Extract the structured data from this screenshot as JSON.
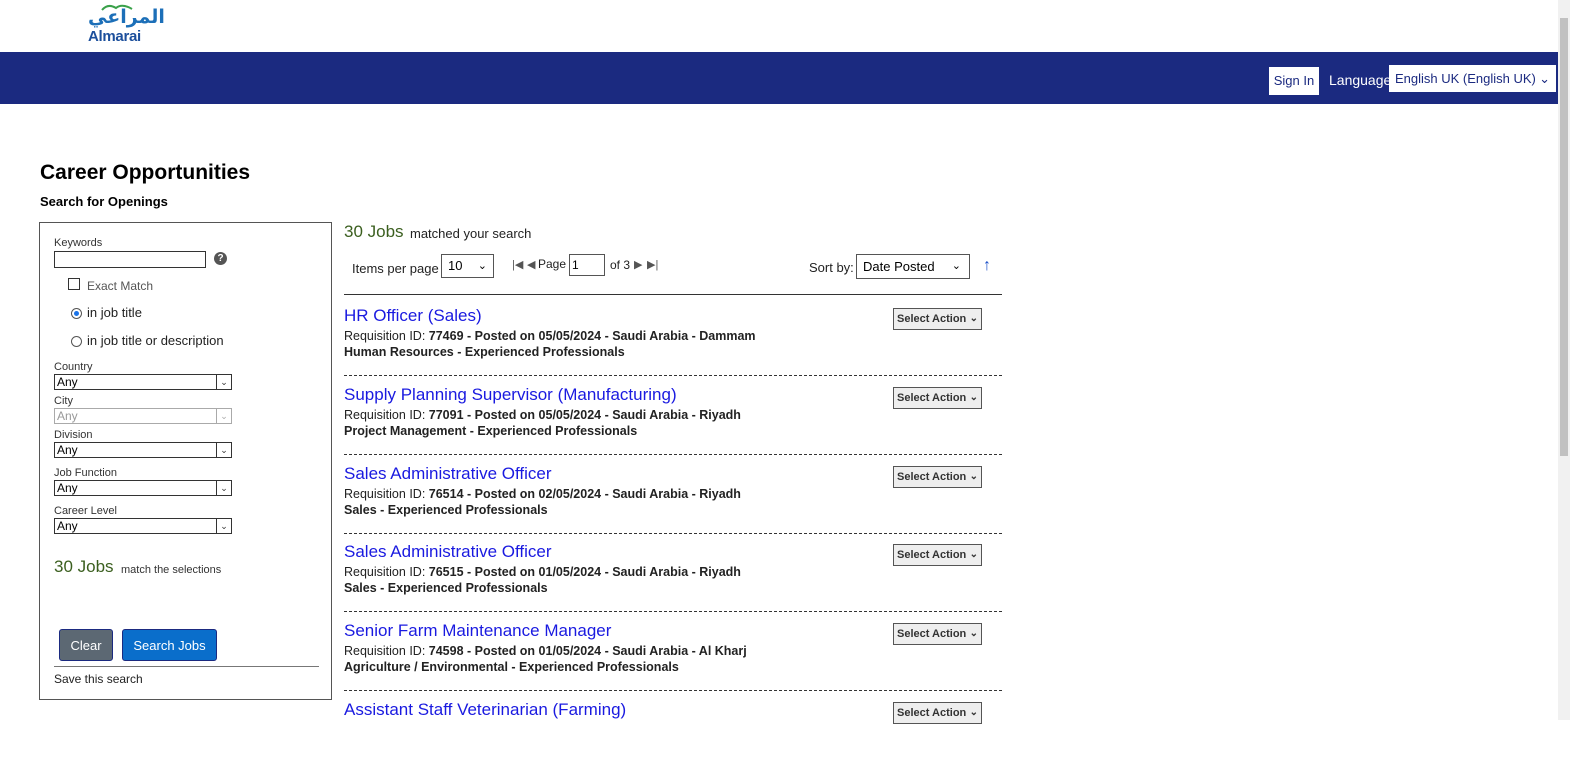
{
  "header": {
    "logo_ar": "المراعي",
    "logo_en": "Almarai",
    "sign_in": "Sign In",
    "language_label": "Language",
    "language_value": "English UK (English UK)"
  },
  "page": {
    "title": "Career Opportunities",
    "subtitle": "Search for Openings"
  },
  "sidebar": {
    "keywords_label": "Keywords",
    "help": "?",
    "exact_match": "Exact Match",
    "radio_title": "in job title",
    "radio_title_desc": "in job title or description",
    "country_label": "Country",
    "country_value": "Any",
    "city_label": "City",
    "city_value": "Any",
    "division_label": "Division",
    "division_value": "Any",
    "job_function_label": "Job Function",
    "job_function_value": "Any",
    "career_level_label": "Career Level",
    "career_level_value": "Any",
    "match_count": "30 Jobs",
    "match_text": "match the selections",
    "clear": "Clear",
    "search": "Search Jobs",
    "save_search": "Save this search"
  },
  "results": {
    "count": "30 Jobs",
    "count_text": "matched your search",
    "items_per_page_label": "Items per page",
    "items_per_page": "10",
    "page_label": "Page",
    "page_value": "1",
    "page_of": "of 3",
    "sort_label": "Sort by:",
    "sort_value": "Date Posted",
    "action_label": "Select Action",
    "jobs": [
      {
        "title": "HR Officer (Sales)",
        "req_label": "Requisition ID:",
        "req": "77469 - Posted on 05/05/2024 - Saudi Arabia  -  Dammam",
        "line2": "Human Resources  -  Experienced Professionals"
      },
      {
        "title": "Supply Planning Supervisor (Manufacturing)",
        "req_label": "Requisition ID:",
        "req": "77091 - Posted on 05/05/2024 - Saudi Arabia  -  Riyadh",
        "line2": "Project Management  -  Experienced Professionals"
      },
      {
        "title": "Sales Administrative Officer",
        "req_label": "Requisition ID:",
        "req": "76514 - Posted on 02/05/2024 - Saudi Arabia  -  Riyadh",
        "line2": "Sales  -  Experienced Professionals"
      },
      {
        "title": "Sales Administrative Officer",
        "req_label": "Requisition ID:",
        "req": "76515 - Posted on 01/05/2024 - Saudi Arabia  -  Riyadh",
        "line2": "Sales  -  Experienced Professionals"
      },
      {
        "title": "Senior Farm Maintenance Manager",
        "req_label": "Requisition ID:",
        "req": "74598 - Posted on 01/05/2024 - Saudi Arabia  -  Al Kharj",
        "line2": "Agriculture / Environmental  -  Experienced Professionals"
      },
      {
        "title": "Assistant Staff Veterinarian (Farming)",
        "req_label": "",
        "req": "",
        "line2": ""
      }
    ]
  },
  "colors": {
    "navbar": "#1b2a80",
    "link": "#1a1ae0",
    "count_green": "#3b5f1f",
    "search_button": "#0a6ecb",
    "clear_button": "#5c6873"
  }
}
